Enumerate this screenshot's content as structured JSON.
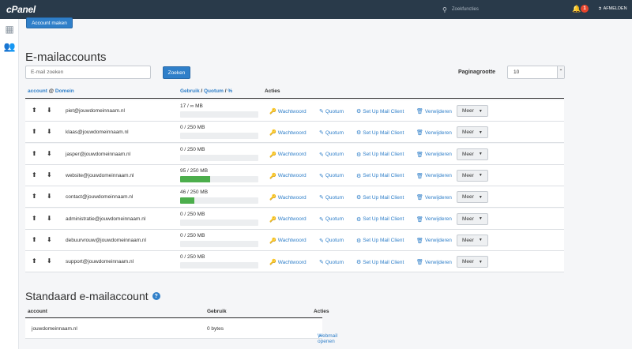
{
  "topbar": {
    "logo": "cPanel",
    "search_placeholder": "Zoekfuncties",
    "notification_count": "1",
    "logout_label": "AFMELDEN"
  },
  "actions": {
    "create_account": "Account maken"
  },
  "email_accounts": {
    "title": "E-mailaccounts",
    "search_placeholder": "E-mail zoeken",
    "search_button": "Zoeken",
    "page_size_label": "Paginagrootte",
    "page_size_value": "10",
    "columns": {
      "account": "account",
      "at": "@",
      "domain": "Domein",
      "usage": "Gebruik",
      "sep1": "/",
      "quota": "Quotum",
      "sep2": "/",
      "percent": "%",
      "actions": "Acties"
    },
    "action_labels": {
      "password": "Wachtwoord",
      "quota": "Quotum",
      "mail_client": "Set Up Mail Client",
      "delete": "Verwijderen",
      "more": "Meer"
    },
    "rows": [
      {
        "email": "piet@jouwdomeinnaam.nl",
        "usage": "17 / ∞ MB",
        "fill": 0
      },
      {
        "email": "klaas@jouwdomeinnaam.nl",
        "usage": "0 / 250 MB",
        "fill": 0
      },
      {
        "email": "jasper@jouwdomeinnaam.nl",
        "usage": "0 / 250 MB",
        "fill": 0
      },
      {
        "email": "website@jouwdomeinnaam.nl",
        "usage": "95 / 250 MB",
        "fill": 0.38
      },
      {
        "email": "contact@jouwdomeinnaam.nl",
        "usage": "46 / 250 MB",
        "fill": 0.18
      },
      {
        "email": "administratie@jouwdomeinnaam.nl",
        "usage": "0 / 250 MB",
        "fill": 0
      },
      {
        "email": "debuurvrouw@jouwdomeinnaam.nl",
        "usage": "0 / 250 MB",
        "fill": 0
      },
      {
        "email": "support@jouwdomeinnaam.nl",
        "usage": "0 / 250 MB",
        "fill": 0
      }
    ]
  },
  "default_account": {
    "title": "Standaard e-mailaccount",
    "columns": {
      "account": "account",
      "usage": "Gebruik",
      "actions": "Acties"
    },
    "row": {
      "account": "jouwdomeinnaam.nl",
      "usage": "0 bytes",
      "action": "Webmail openen"
    }
  },
  "colors": {
    "topbar": "#293a4a",
    "accent": "#2f7fc9",
    "bar_fill": "#4cae4c",
    "badge": "#e8452c"
  }
}
